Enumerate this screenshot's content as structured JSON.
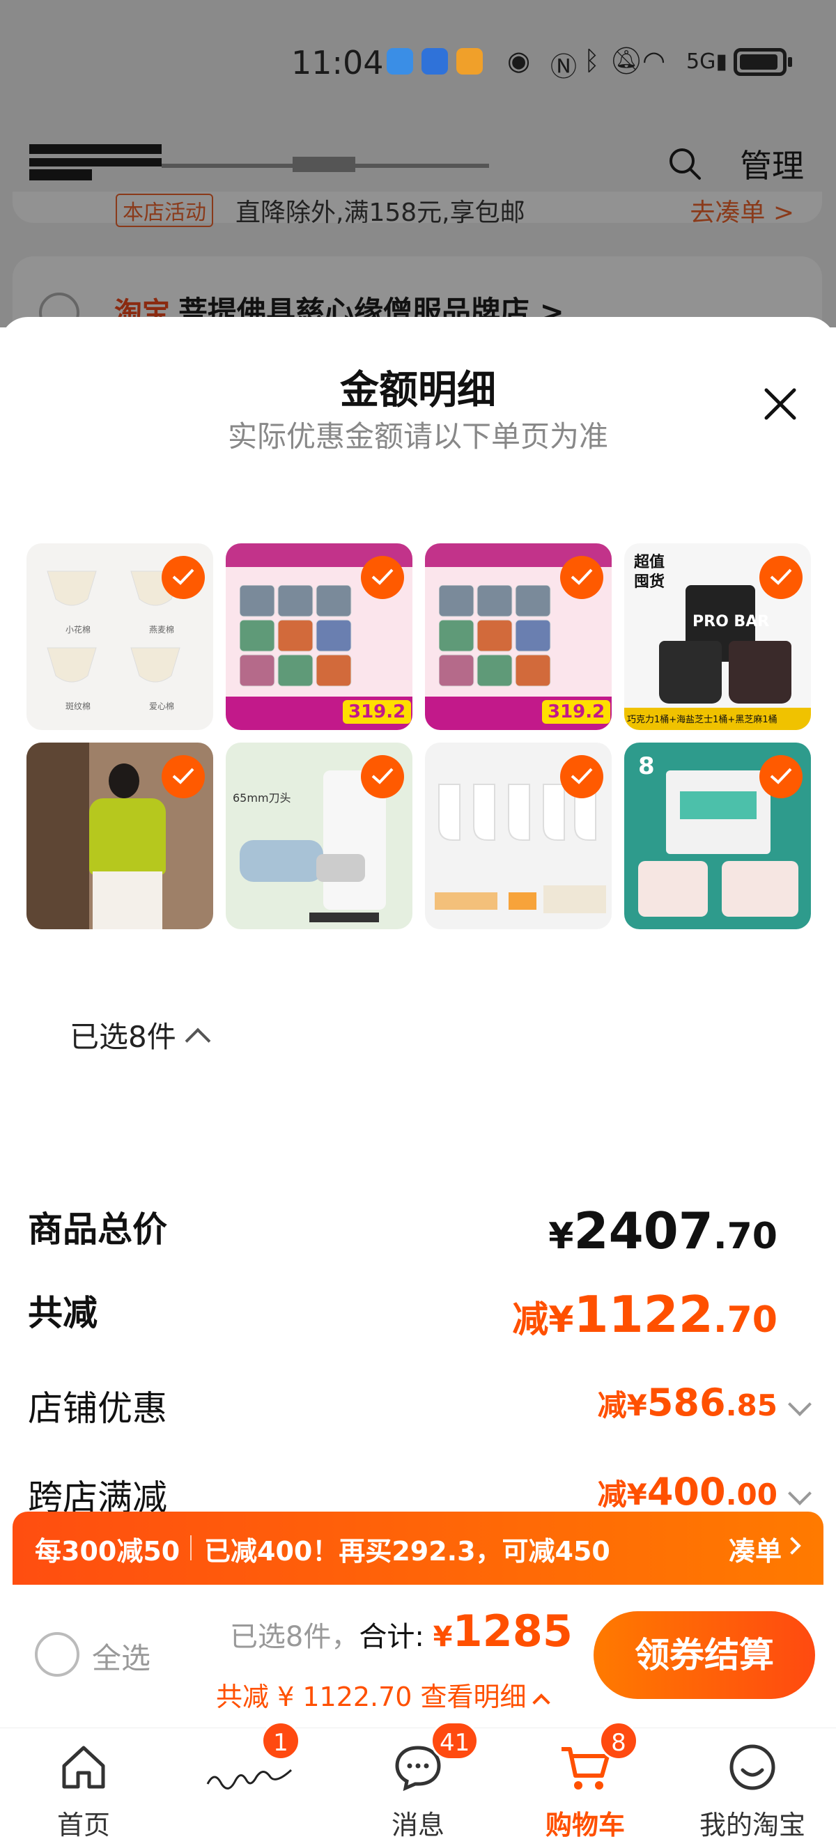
{
  "status_bar": {
    "time": "11:04"
  },
  "background_page": {
    "manage_label": "管理",
    "promo_tag": "本店活动",
    "promo_text": "直降除外,满158元,享包邮",
    "gather_link": "去凑单 >",
    "taobao_label": "淘宝",
    "shop_name": "菩提佛具慈心缘僧服品牌店 >"
  },
  "sheet": {
    "title": "金额明细",
    "subtitle": "实际优惠金额请以下单页为准",
    "selected_count": "已选8件",
    "rows": [
      {
        "label": "商品总价",
        "value_prefix": "¥",
        "value_int": "2407",
        "value_dec": ".70"
      },
      {
        "label": "共减",
        "value_prefix": "减¥",
        "value_int": "1122",
        "value_dec": ".70"
      },
      {
        "label": "店铺优惠",
        "value_prefix": "减¥",
        "value_int": "586",
        "value_dec": ".85"
      },
      {
        "label": "跨店满减",
        "value_prefix": "减¥",
        "value_int": "400",
        "value_dec": ".00"
      }
    ]
  },
  "product_thumbs": [
    {
      "name": "underwear"
    },
    {
      "name": "cat-food-cans-1"
    },
    {
      "name": "cat-food-cans-2"
    },
    {
      "name": "pro-bar-tubs"
    },
    {
      "name": "green-blouse"
    },
    {
      "name": "pet-grooming-comb"
    },
    {
      "name": "white-socks"
    },
    {
      "name": "adult-diapers"
    }
  ],
  "thumb_text": {
    "u1": "小花棉",
    "u2": "燕麦棉",
    "u3": "斑纹棉",
    "u4": "爱心棉",
    "can_price": "319.2",
    "bar_header": "超值囤货",
    "bar_brand": "PRO BAR",
    "bar_caption": "巧克力1桶+海盐芝士1桶+黑芝麻1桶",
    "comb_caption": "65mm刀头",
    "diaper_count": "8"
  },
  "promo_strip": {
    "rule": "每300减50",
    "message": "已减400！再买292.3，可减450",
    "action": "凑单"
  },
  "checkout": {
    "select_all": "全选",
    "selected": "已选8件，",
    "total_label": "合计: ",
    "currency": "¥",
    "total_amount": "1285",
    "saving": "共减 ¥ 1122.70  查看明细",
    "button": "领券结算"
  },
  "nav": {
    "items": [
      {
        "label": "首页",
        "badge": ""
      },
      {
        "label": "",
        "badge": "1"
      },
      {
        "label": "消息",
        "badge": "41"
      },
      {
        "label": "购物车",
        "badge": "8"
      },
      {
        "label": "我的淘宝",
        "badge": ""
      }
    ]
  },
  "colors": {
    "accent": "#ff5000",
    "check": "#ff5a00",
    "overlay": "#8a8a8a"
  }
}
